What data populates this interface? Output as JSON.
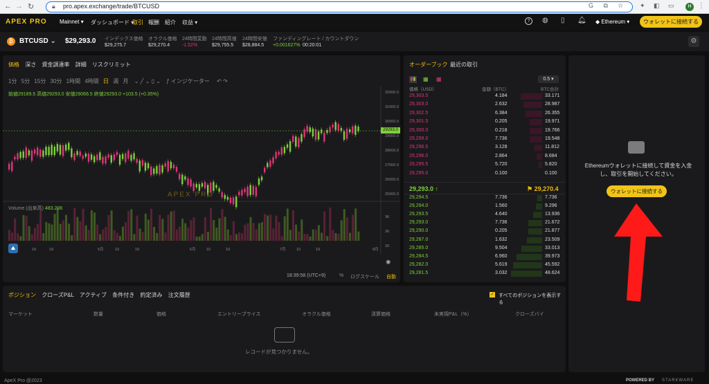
{
  "browser": {
    "url": "pro.apex.exchange/trade/BTCUSD"
  },
  "nav": {
    "logo": "APEX PRO",
    "network": "Mainnet",
    "items": [
      "ダッシュボード",
      "取引",
      "報酬",
      "紹介",
      "収益"
    ],
    "chain": "Ethereum",
    "connect": "ウォレットに接続する"
  },
  "ticker": {
    "pair": "BTCUSD",
    "price": "$29,293.0",
    "stats": [
      {
        "label": "インデックス価格",
        "value": "$29,275.7"
      },
      {
        "label": "オラクル価格",
        "value": "$29,270.4"
      },
      {
        "label": "24時間変動",
        "value": "-1.52%"
      },
      {
        "label": "24時間高値",
        "value": "$29,755.5"
      },
      {
        "label": "24時間安値",
        "value": "$28,884.5"
      },
      {
        "label": "ファンディングレート / カウントダウン",
        "value": "+0.001627%",
        "extra": "00:20:01"
      }
    ]
  },
  "chart": {
    "tabs": [
      "価格",
      "深さ",
      "資金調達率",
      "詳細",
      "リスクリミット"
    ],
    "intervals": [
      "1分",
      "5分",
      "15分",
      "30分",
      "1時間",
      "4時間",
      "日",
      "週",
      "月"
    ],
    "indicator": "インジケーター",
    "ohlc": "始値29189.5 高値29293.0 安値29066.5 終値29293.0 +103.5 (+0.35%)",
    "price_tag": "29293.0",
    "yticks": [
      "32000.0",
      "31000.0",
      "30000.0",
      "29000.0",
      "28000.0",
      "27000.0",
      "26000.0",
      "25000.0"
    ],
    "vol_label": "Volume (出来高)",
    "vol_value": "483.206",
    "vol_ticks": [
      "3K",
      "2K",
      "1K"
    ],
    "xticks": [
      "4月",
      "10",
      "19",
      "5月",
      "10",
      "19",
      "6月",
      "10",
      "19",
      "7月",
      "10",
      "19",
      "8月"
    ],
    "time": "18:39:58 (UTC+9)",
    "pct": "%",
    "log": "ログスケール",
    "auto": "自動",
    "watermark": "APEX PRO"
  },
  "orderbook": {
    "tabs": [
      "オーダーブック",
      "最近の取引"
    ],
    "step": "0.5",
    "headers": [
      "価格（USD）",
      "金額（BTC）",
      "BTC合計"
    ],
    "asks": [
      [
        "29,303.5",
        "4.184",
        "33.171"
      ],
      [
        "29,303.0",
        "2.632",
        "28.987"
      ],
      [
        "29,302.5",
        "6.384",
        "26.355"
      ],
      [
        "29,301.5",
        "0.205",
        "19.971"
      ],
      [
        "29,300.0",
        "0.218",
        "19.766"
      ],
      [
        "29,299.0",
        "7.736",
        "19.548"
      ],
      [
        "29,296.5",
        "3.128",
        "11.812"
      ],
      [
        "29,296.0",
        "2.864",
        "8.684"
      ],
      [
        "29,295.5",
        "5.720",
        "5.820"
      ],
      [
        "29,295.0",
        "0.100",
        "0.100"
      ]
    ],
    "last": "29,293.0 ↑",
    "oracle": "29,270.4",
    "bids": [
      [
        "29,294.5",
        "7.736",
        "7.736"
      ],
      [
        "29,294.0",
        "1.560",
        "9.296"
      ],
      [
        "29,293.5",
        "4.640",
        "13.936"
      ],
      [
        "29,293.0",
        "7.736",
        "21.672"
      ],
      [
        "29,290.0",
        "0.205",
        "21.877"
      ],
      [
        "29,287.0",
        "1.632",
        "23.509"
      ],
      [
        "29,285.0",
        "9.504",
        "33.013"
      ],
      [
        "29,284.5",
        "6.960",
        "39.973"
      ],
      [
        "29,282.0",
        "5.619",
        "45.592"
      ],
      [
        "29,281.5",
        "3.032",
        "48.624"
      ]
    ]
  },
  "wallet": {
    "message": "Ethereumウォレットに接続して資金を入金し、取引を開始してください。",
    "button": "ウォレットに接続する"
  },
  "positions": {
    "tabs": [
      "ポジション",
      "クローズP&L",
      "アクティブ",
      "条件付き",
      "約定済み",
      "注文履歴"
    ],
    "show_all": "すべてのポジションを表示する",
    "columns": [
      "マーケット",
      "数量",
      "価格",
      "エントリープライス",
      "オラクル価格",
      "清算価格",
      "未実現P&L（%）",
      "クローズバイ"
    ],
    "empty": "レコードが見つかりません。"
  },
  "footer": {
    "copy": "ApeX Pro @2023",
    "powered": "POWERED BY",
    "brand": "STARKWARE"
  }
}
